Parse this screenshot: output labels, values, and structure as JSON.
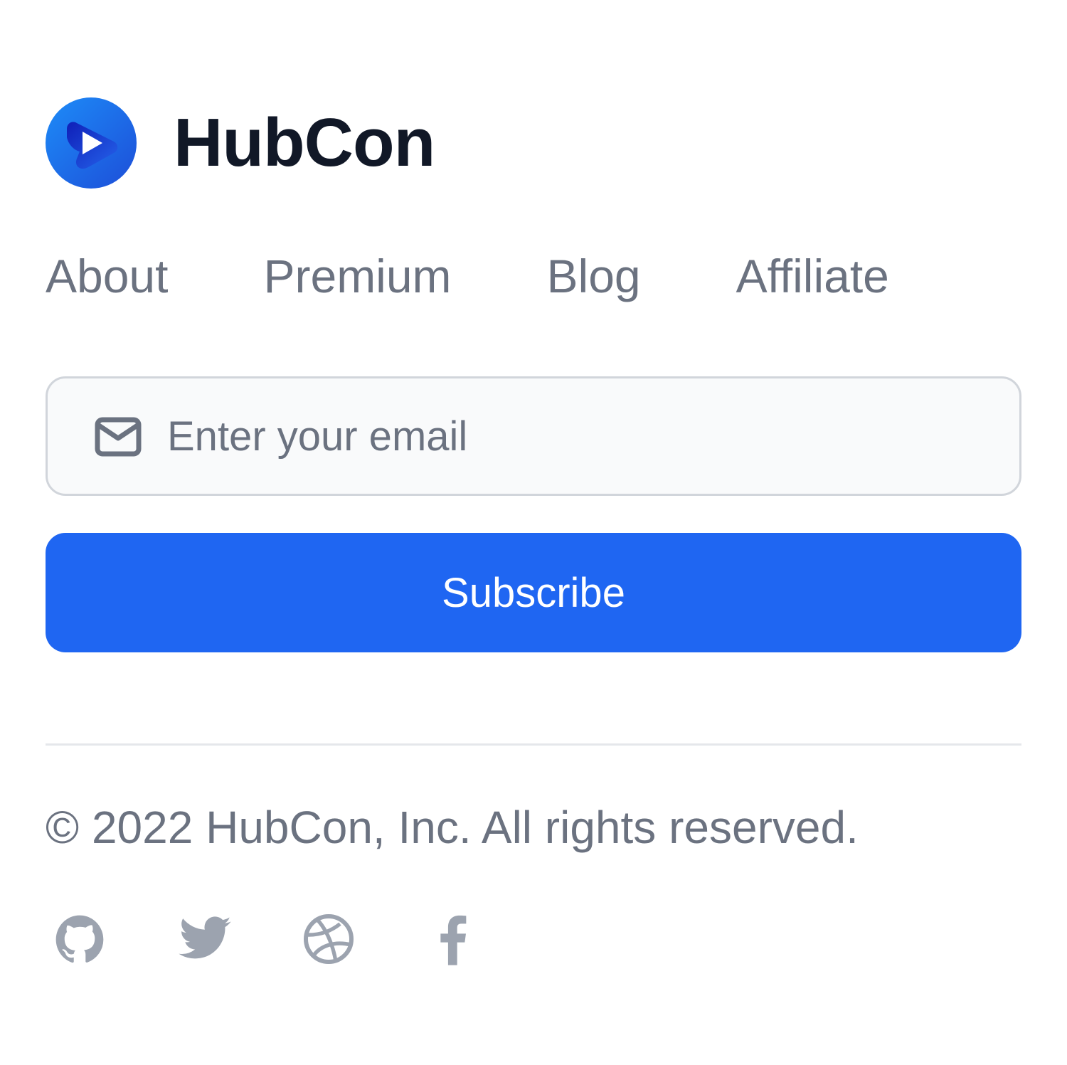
{
  "brand": {
    "name": "HubCon",
    "logo_icon": "play-circle-logo-icon",
    "logo_colors": [
      "#1d8cf8",
      "#1d4ed8"
    ]
  },
  "nav": {
    "items": [
      {
        "label": "About"
      },
      {
        "label": "Premium"
      },
      {
        "label": "Blog"
      },
      {
        "label": "Affiliate"
      }
    ]
  },
  "newsletter": {
    "email_placeholder": "Enter your email",
    "email_value": "",
    "email_icon": "envelope-icon",
    "subscribe_label": "Subscribe",
    "button_color": "#1f66f2"
  },
  "footer": {
    "copyright": "© 2022 HubCon, Inc. All rights reserved.",
    "social": [
      {
        "icon": "github-icon"
      },
      {
        "icon": "twitter-icon"
      },
      {
        "icon": "dribbble-icon"
      },
      {
        "icon": "facebook-icon"
      }
    ]
  }
}
